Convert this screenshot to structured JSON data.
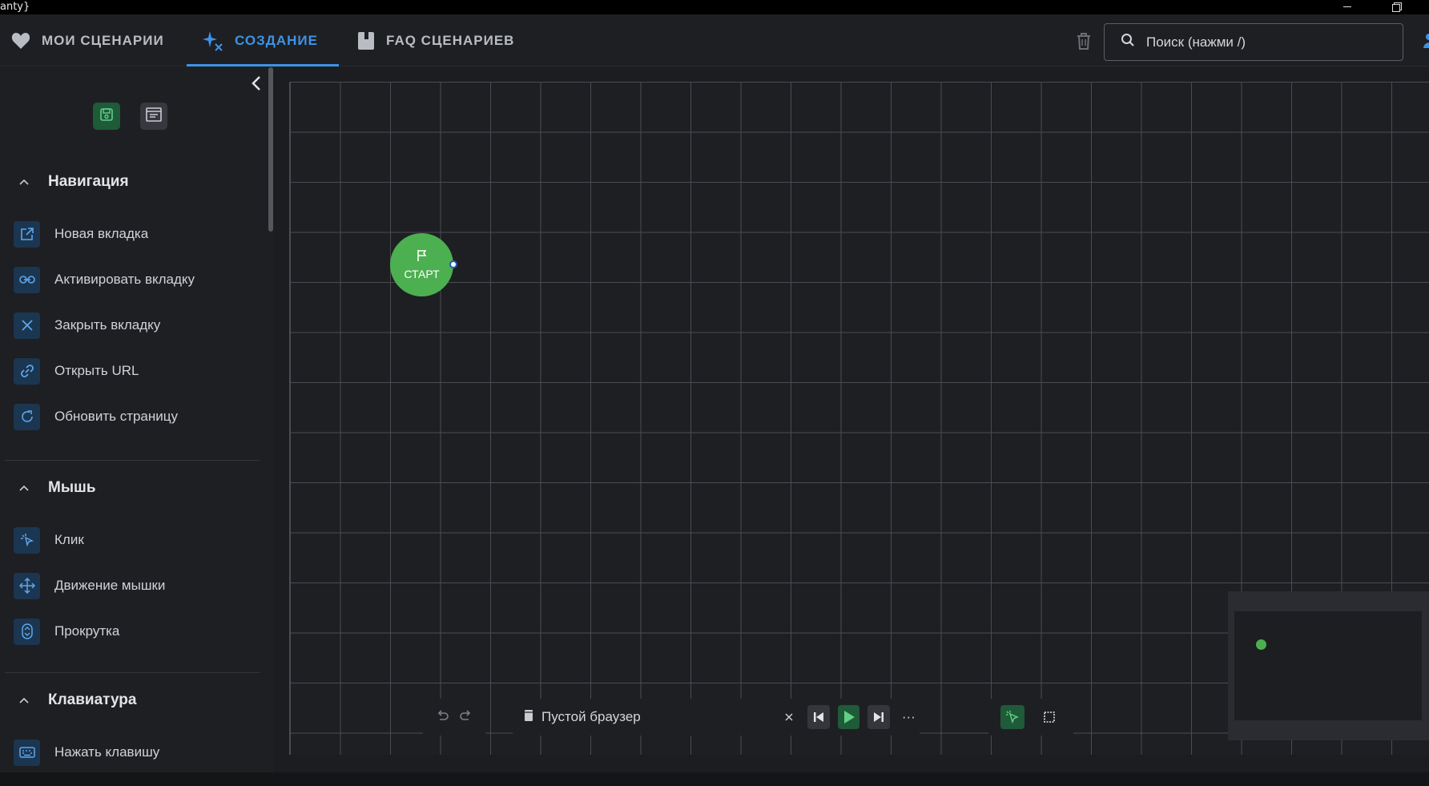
{
  "window": {
    "title": "anty}"
  },
  "nav": {
    "tabs": [
      {
        "label": "МОИ СЦЕНАРИИ",
        "icon": "heart-icon"
      },
      {
        "label": "СОЗДАНИЕ",
        "icon": "sparkles-icon",
        "active": true
      },
      {
        "label": "FAQ СЦЕНАРИЕВ",
        "icon": "book-icon"
      }
    ],
    "search": {
      "placeholder": "Поиск (нажми /)"
    }
  },
  "sidebar": {
    "sections": [
      {
        "title": "Навигация",
        "items": [
          {
            "label": "Новая вкладка",
            "icon": "open-tab-icon"
          },
          {
            "label": "Активировать вкладку",
            "icon": "link-icon"
          },
          {
            "label": "Закрыть вкладку",
            "icon": "close-icon"
          },
          {
            "label": "Открыть URL",
            "icon": "chain-link-icon"
          },
          {
            "label": "Обновить страницу",
            "icon": "refresh-icon"
          }
        ]
      },
      {
        "title": "Мышь",
        "items": [
          {
            "label": "Клик",
            "icon": "cursor-click-icon"
          },
          {
            "label": "Движение мышки",
            "icon": "move-icon"
          },
          {
            "label": "Прокрутка",
            "icon": "scroll-icon"
          }
        ]
      },
      {
        "title": "Клавиатура",
        "items": [
          {
            "label": "Нажать клавишу",
            "icon": "keyboard-icon"
          }
        ]
      }
    ]
  },
  "canvas": {
    "start_node_label": "СТАРТ"
  },
  "runbar": {
    "profile_label": "Пустой браузер",
    "more": "···"
  },
  "colors": {
    "accent": "#3d93e6",
    "start_green": "#4caf50",
    "background": "#1e1f23"
  }
}
